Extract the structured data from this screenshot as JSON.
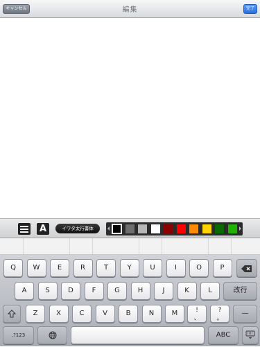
{
  "navbar": {
    "title": "編集",
    "cancel_label": "キャンセル",
    "done_label": "完了"
  },
  "toolbar": {
    "menu_icon": "list-icon",
    "font_icon_label": "A",
    "font_name": "イワタ太行書体",
    "palette": [
      {
        "name": "black",
        "color": "#000000",
        "selected": true
      },
      {
        "name": "dark-gray",
        "color": "#6e6e6e"
      },
      {
        "name": "light-gray",
        "color": "#b7b7b7"
      },
      {
        "name": "white",
        "color": "#ffffff"
      },
      {
        "name": "dark-red",
        "color": "#8b0000"
      },
      {
        "name": "red",
        "color": "#ff0000"
      },
      {
        "name": "orange",
        "color": "#ff8a00"
      },
      {
        "name": "yellow",
        "color": "#ffd400"
      },
      {
        "name": "dark-green",
        "color": "#0a6a00"
      },
      {
        "name": "green",
        "color": "#1fb300"
      }
    ]
  },
  "keyboard": {
    "row1": [
      "Q",
      "W",
      "E",
      "R",
      "T",
      "Y",
      "U",
      "I",
      "O",
      "P"
    ],
    "row2": [
      "A",
      "S",
      "D",
      "F",
      "G",
      "H",
      "J",
      "K",
      "L"
    ],
    "row3": [
      "Z",
      "X",
      "C",
      "V",
      "B",
      "N",
      "M"
    ],
    "return_label": "改行",
    "excl_top": "!",
    "excl_bottom": "、",
    "question_top": "?",
    "question_bottom": "。",
    "dash_label": "—",
    "numbers_label": ".?123",
    "abc_label": "ABC",
    "shift_icon": "shift-icon",
    "backspace_icon": "backspace-icon",
    "globe_icon": "globe-icon",
    "hide_keyboard_icon": "keyboard-hide-icon"
  }
}
